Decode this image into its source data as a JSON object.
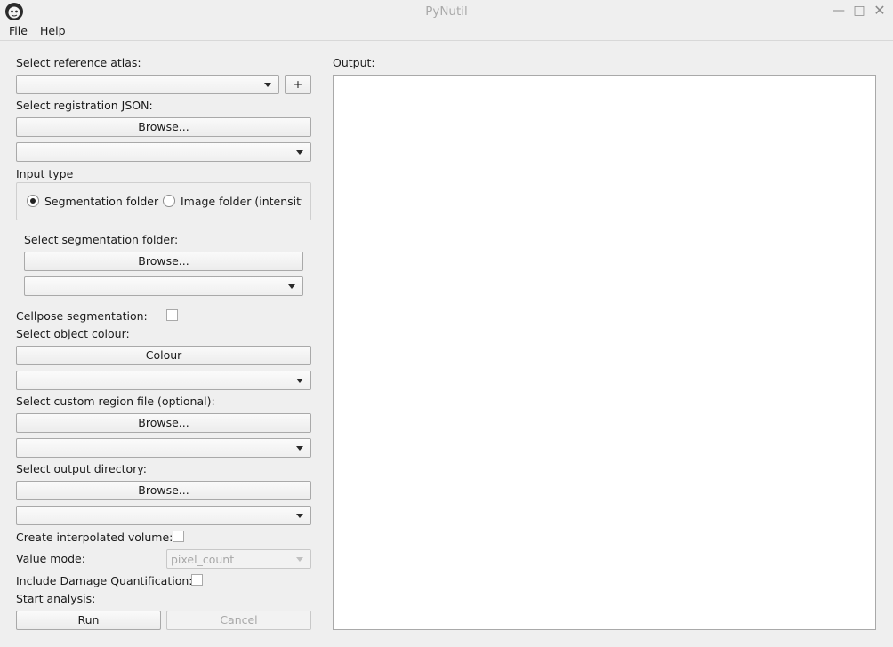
{
  "window": {
    "title": "PyNutil"
  },
  "menu": {
    "file": "File",
    "help": "Help"
  },
  "atlas": {
    "label": "Select reference atlas:",
    "add_button": "+"
  },
  "registration": {
    "label": "Select registration JSON:",
    "browse": "Browse..."
  },
  "input_type": {
    "label": "Input type",
    "options": [
      "Segmentation folder",
      "Image folder (intensity"
    ],
    "selected": 0
  },
  "segmentation": {
    "label": "Select segmentation folder:",
    "browse": "Browse..."
  },
  "cellpose": {
    "label": "Cellpose segmentation:"
  },
  "colour": {
    "label": "Select object colour:",
    "button": "Colour"
  },
  "custom_region": {
    "label": "Select custom region file (optional):",
    "browse": "Browse..."
  },
  "output_dir": {
    "label": "Select output directory:",
    "browse": "Browse..."
  },
  "interpolated": {
    "label": "Create interpolated volume:"
  },
  "value_mode": {
    "label": "Value mode:",
    "value": "pixel_count"
  },
  "damage": {
    "label": "Include Damage Quantification:"
  },
  "analysis": {
    "label": "Start analysis:",
    "run": "Run",
    "cancel": "Cancel"
  },
  "output": {
    "label": "Output:"
  }
}
